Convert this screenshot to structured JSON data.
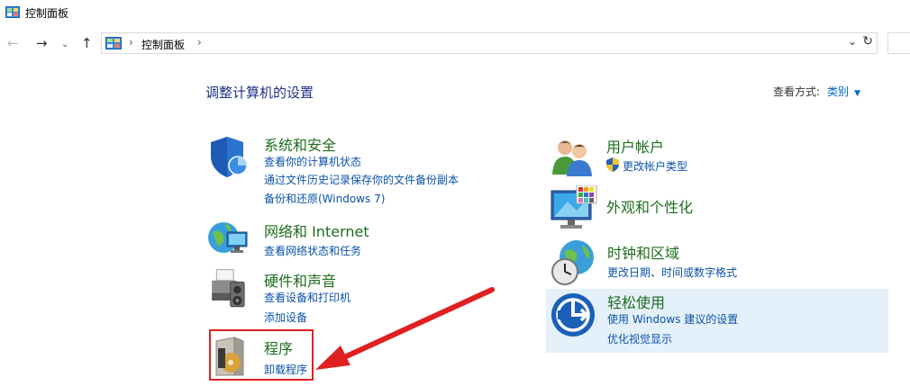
{
  "window": {
    "title": "控制面板"
  },
  "address": {
    "crumb": "控制面板"
  },
  "page": {
    "heading": "调整计算机的设置",
    "view_by_label": "查看方式:",
    "view_by_value": "类别"
  },
  "categories": {
    "security": {
      "title": "系统和安全",
      "links": [
        "查看你的计算机状态",
        "通过文件历史记录保存你的文件备份副本",
        "备份和还原(Windows 7)"
      ]
    },
    "network": {
      "title": "网络和 Internet",
      "links": [
        "查看网络状态和任务"
      ]
    },
    "hardware": {
      "title": "硬件和声音",
      "links": [
        "查看设备和打印机",
        "添加设备"
      ]
    },
    "programs": {
      "title": "程序",
      "links": [
        "卸载程序"
      ]
    },
    "users": {
      "title": "用户帐户",
      "links": [
        "更改帐户类型"
      ]
    },
    "appearance": {
      "title": "外观和个性化",
      "links": []
    },
    "clock": {
      "title": "时钟和区域",
      "links": [
        "更改日期、时间或数字格式"
      ]
    },
    "ease": {
      "title": "轻松使用",
      "links": [
        "使用 Windows 建议的设置",
        "优化视觉显示"
      ]
    }
  },
  "colors": {
    "category_title": "#1d6d1d",
    "link": "#0a52a8",
    "heading": "#1e3287",
    "highlight": "#e4f0fa",
    "annotation": "#e02020"
  },
  "icons": [
    "control-panel-icon",
    "shield-icon",
    "globe-network-icon",
    "printer-speaker-icon",
    "program-box-icon",
    "users-icon",
    "uac-shield-icon",
    "monitor-palette-icon",
    "clock-globe-icon",
    "ease-of-access-icon"
  ]
}
